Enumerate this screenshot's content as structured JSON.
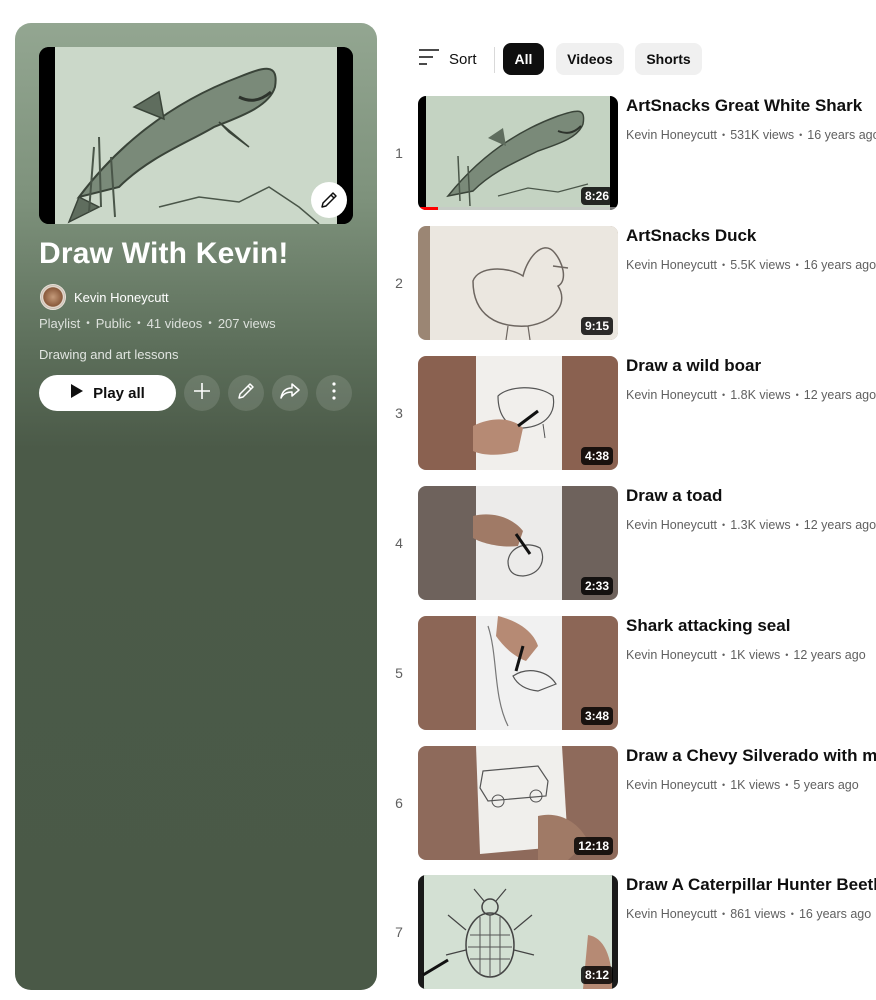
{
  "playlist": {
    "title": "Draw With Kevin!",
    "owner": "Kevin Honeycutt",
    "type": "Playlist",
    "visibility": "Public",
    "video_count": "41 videos",
    "views": "207 views",
    "description": "Drawing and art lessons",
    "play_all_label": "Play all",
    "icons": {
      "edit_thumbnail": "pencil-icon",
      "play": "play-icon",
      "add": "plus-icon",
      "edit": "pencil-icon",
      "share": "share-icon",
      "more": "more-vert-icon"
    }
  },
  "filters": {
    "sort_label": "Sort",
    "chips": [
      "All",
      "Videos",
      "Shorts"
    ],
    "active_chip": "All"
  },
  "videos": [
    {
      "index": "1",
      "title": "ArtSnacks Great White Shark",
      "channel": "Kevin Honeycutt",
      "views": "531K views",
      "age": "16 years ago",
      "duration": "8:26",
      "watched_fraction": 0.1
    },
    {
      "index": "2",
      "title": "ArtSnacks Duck",
      "channel": "Kevin Honeycutt",
      "views": "5.5K views",
      "age": "16 years ago",
      "duration": "9:15"
    },
    {
      "index": "3",
      "title": "Draw a wild boar",
      "channel": "Kevin Honeycutt",
      "views": "1.8K views",
      "age": "12 years ago",
      "duration": "4:38"
    },
    {
      "index": "4",
      "title": "Draw a toad",
      "channel": "Kevin Honeycutt",
      "views": "1.3K views",
      "age": "12 years ago",
      "duration": "2:33"
    },
    {
      "index": "5",
      "title": "Shark attacking seal",
      "channel": "Kevin Honeycutt",
      "views": "1K views",
      "age": "12 years ago",
      "duration": "3:48"
    },
    {
      "index": "6",
      "title": "Draw a Chevy Silverado with me!",
      "channel": "Kevin Honeycutt",
      "views": "1K views",
      "age": "5 years ago",
      "duration": "12:18"
    },
    {
      "index": "7",
      "title": "Draw A Caterpillar Hunter Beetle",
      "channel": "Kevin Honeycutt",
      "views": "861 views",
      "age": "16 years ago",
      "duration": "8:12"
    }
  ],
  "colors": {
    "panel_top": "#93a691",
    "panel_bottom": "#4a5947",
    "progress": "#ff0000",
    "chip_active": "#0f0f0f",
    "chip_inactive": "#f0f0f0"
  }
}
